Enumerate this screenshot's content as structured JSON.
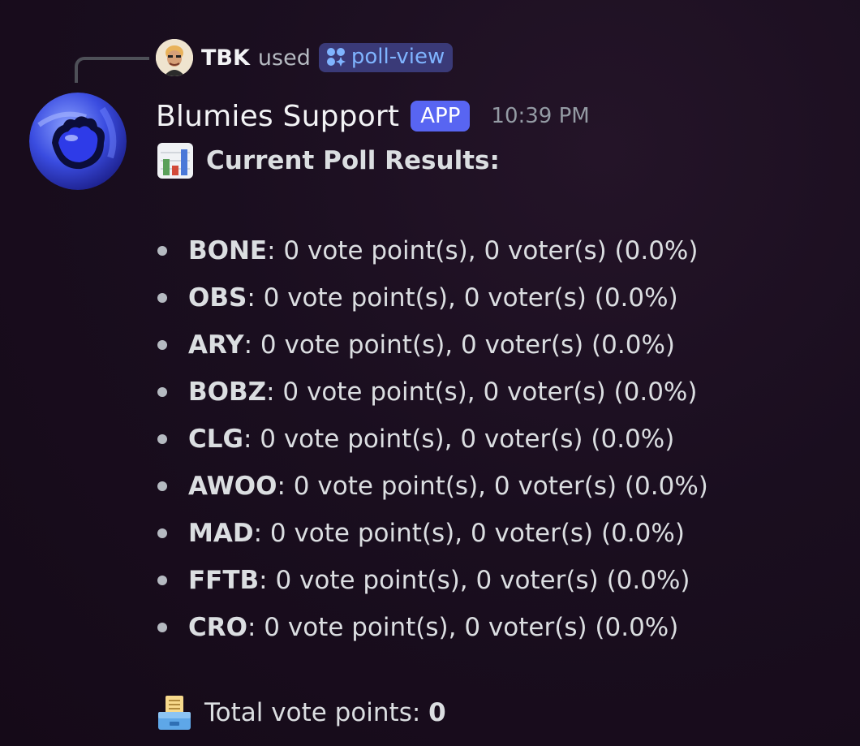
{
  "reply": {
    "user": "TBK",
    "used_text": "used",
    "command": "poll-view",
    "avatar_icon": "user-portrait-avatar",
    "command_icon": "sparkle-app-command-icon"
  },
  "message": {
    "author": "Blumies Support",
    "badge": "APP",
    "timestamp": "10:39 PM",
    "avatar_icon": "blue-hand-orb-avatar",
    "title_icon": "bar-chart-emoji",
    "title": "Current Poll Results:",
    "results": [
      {
        "name": "BONE",
        "text": ": 0 vote point(s), 0 voter(s) (0.0%)"
      },
      {
        "name": "OBS",
        "text": ": 0 vote point(s), 0 voter(s) (0.0%)"
      },
      {
        "name": "ARY",
        "text": ": 0 vote point(s), 0 voter(s) (0.0%)"
      },
      {
        "name": "BOBZ",
        "text": ": 0 vote point(s), 0 voter(s) (0.0%)"
      },
      {
        "name": "CLG",
        "text": ": 0 vote point(s), 0 voter(s) (0.0%)"
      },
      {
        "name": "AWOO",
        "text": ": 0 vote point(s), 0 voter(s) (0.0%)"
      },
      {
        "name": "MAD",
        "text": ": 0 vote point(s), 0 voter(s) (0.0%)"
      },
      {
        "name": "FFTB",
        "text": ": 0 vote point(s), 0 voter(s) (0.0%)"
      },
      {
        "name": "CRO",
        "text": ": 0 vote point(s), 0 voter(s) (0.0%)"
      }
    ],
    "total_icon": "ballot-box-emoji",
    "total_label": "Total vote points: ",
    "total_value": "0"
  },
  "colors": {
    "background": "#1a0e1f",
    "badge": "#5865f2",
    "command_pill": "#3a3a78",
    "command_text": "#7fb4ff"
  }
}
